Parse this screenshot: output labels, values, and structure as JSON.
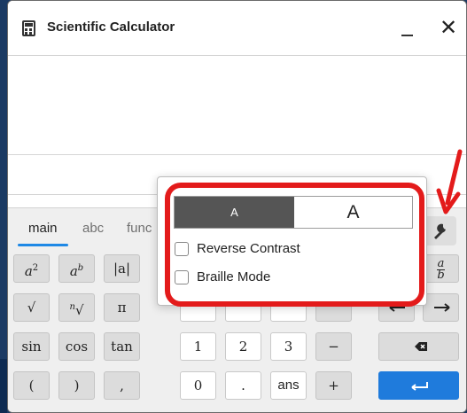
{
  "window": {
    "title": "Scientific Calculator",
    "minimize_icon": "minimize-icon",
    "close_label": "✕"
  },
  "tabs": [
    {
      "label": "main"
    },
    {
      "label": "abc"
    },
    {
      "label": "func"
    }
  ],
  "keys": {
    "pi": "π",
    "sin": "sin",
    "cos": "cos",
    "tan": "tan",
    "one": "1",
    "two": "2",
    "three": "3",
    "minus": "−",
    "open_paren": "(",
    "close_paren": ")",
    "comma": ",",
    "zero": "0",
    "dot": ".",
    "ans": "ans",
    "plus": "+",
    "abs": "|a|",
    "frac_num": "a",
    "frac_den": "b"
  },
  "settings_popup": {
    "small_text_label": "A",
    "large_text_label": "A",
    "options": [
      {
        "label": "Reverse Contrast",
        "checked": false
      },
      {
        "label": "Braille Mode",
        "checked": false
      }
    ]
  },
  "colors": {
    "accent": "#1e88e5",
    "enter": "#1f7bdc",
    "annotation": "#e31b1b"
  }
}
